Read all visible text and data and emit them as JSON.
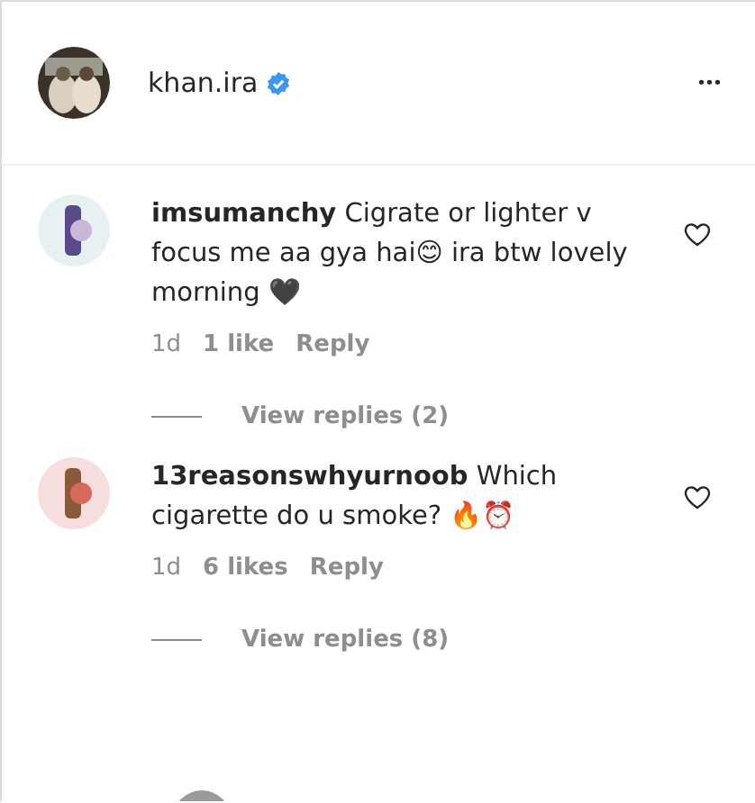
{
  "post_header": {
    "username": "khan.ira",
    "verified": true,
    "more": "•••"
  },
  "comments": [
    {
      "username": "imsumanchy",
      "text": "Cigrate or lighter v focus me aa gya hai😊 ira btw lovely morning 🖤",
      "age": "1d",
      "likes": "1 like",
      "reply": "Reply",
      "liked": false,
      "view_replies": "View replies (2)"
    },
    {
      "username": "13reasonswhyurnoob",
      "text": "Which cigarette do u smoke? 🔥⏰",
      "age": "1d",
      "likes": "6 likes",
      "reply": "Reply",
      "liked": false,
      "view_replies": "View replies (8)"
    }
  ]
}
